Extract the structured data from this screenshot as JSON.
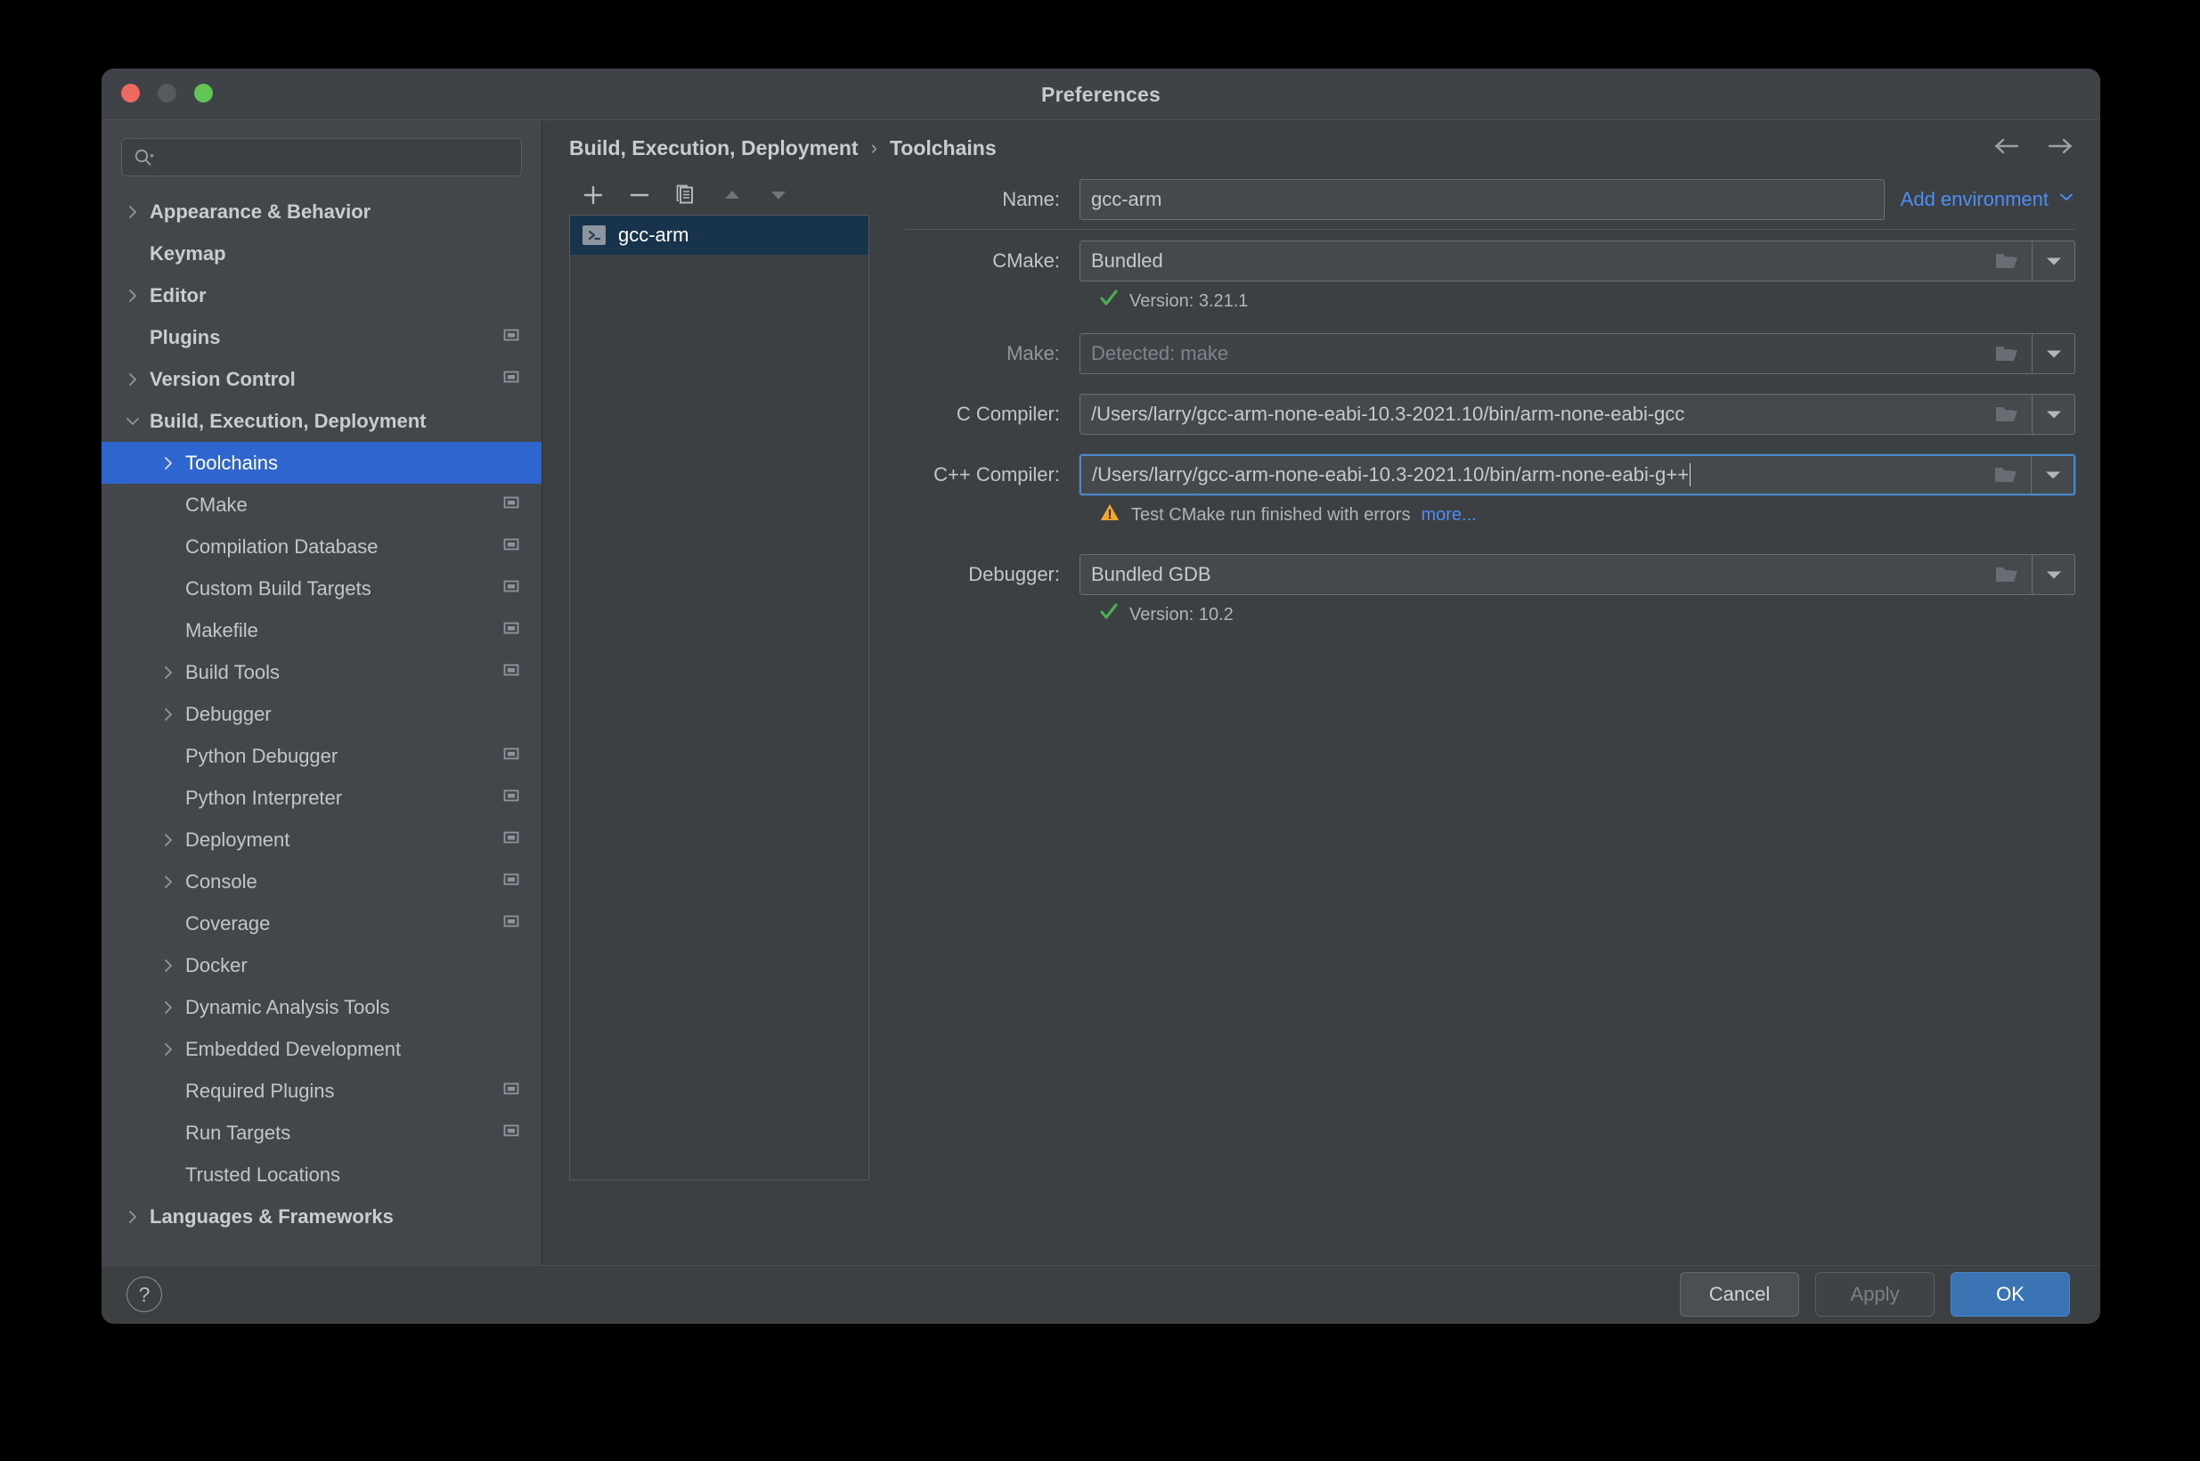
{
  "window": {
    "title": "Preferences",
    "traffic_lights": [
      "close",
      "minimize",
      "maximize"
    ]
  },
  "search": {
    "value": "",
    "placeholder": ""
  },
  "sidebar": {
    "items": [
      {
        "label": "Appearance & Behavior",
        "level": 0,
        "arrow": "right",
        "bold": true,
        "module": false,
        "selected": false
      },
      {
        "label": "Keymap",
        "level": 0,
        "arrow": "none",
        "bold": true,
        "module": false,
        "selected": false
      },
      {
        "label": "Editor",
        "level": 0,
        "arrow": "right",
        "bold": true,
        "module": false,
        "selected": false
      },
      {
        "label": "Plugins",
        "level": 0,
        "arrow": "none",
        "bold": true,
        "module": true,
        "selected": false
      },
      {
        "label": "Version Control",
        "level": 0,
        "arrow": "right",
        "bold": true,
        "module": true,
        "selected": false
      },
      {
        "label": "Build, Execution, Deployment",
        "level": 0,
        "arrow": "down",
        "bold": true,
        "module": false,
        "selected": false
      },
      {
        "label": "Toolchains",
        "level": 1,
        "arrow": "right",
        "bold": false,
        "module": false,
        "selected": true
      },
      {
        "label": "CMake",
        "level": 1,
        "arrow": "none",
        "bold": false,
        "module": true,
        "selected": false
      },
      {
        "label": "Compilation Database",
        "level": 1,
        "arrow": "none",
        "bold": false,
        "module": true,
        "selected": false
      },
      {
        "label": "Custom Build Targets",
        "level": 1,
        "arrow": "none",
        "bold": false,
        "module": true,
        "selected": false
      },
      {
        "label": "Makefile",
        "level": 1,
        "arrow": "none",
        "bold": false,
        "module": true,
        "selected": false
      },
      {
        "label": "Build Tools",
        "level": 1,
        "arrow": "right",
        "bold": false,
        "module": true,
        "selected": false
      },
      {
        "label": "Debugger",
        "level": 1,
        "arrow": "right",
        "bold": false,
        "module": false,
        "selected": false
      },
      {
        "label": "Python Debugger",
        "level": 1,
        "arrow": "none",
        "bold": false,
        "module": true,
        "selected": false
      },
      {
        "label": "Python Interpreter",
        "level": 1,
        "arrow": "none",
        "bold": false,
        "module": true,
        "selected": false
      },
      {
        "label": "Deployment",
        "level": 1,
        "arrow": "right",
        "bold": false,
        "module": true,
        "selected": false
      },
      {
        "label": "Console",
        "level": 1,
        "arrow": "right",
        "bold": false,
        "module": true,
        "selected": false
      },
      {
        "label": "Coverage",
        "level": 1,
        "arrow": "none",
        "bold": false,
        "module": true,
        "selected": false
      },
      {
        "label": "Docker",
        "level": 1,
        "arrow": "right",
        "bold": false,
        "module": false,
        "selected": false
      },
      {
        "label": "Dynamic Analysis Tools",
        "level": 1,
        "arrow": "right",
        "bold": false,
        "module": false,
        "selected": false
      },
      {
        "label": "Embedded Development",
        "level": 1,
        "arrow": "right",
        "bold": false,
        "module": false,
        "selected": false
      },
      {
        "label": "Required Plugins",
        "level": 1,
        "arrow": "none",
        "bold": false,
        "module": true,
        "selected": false
      },
      {
        "label": "Run Targets",
        "level": 1,
        "arrow": "none",
        "bold": false,
        "module": true,
        "selected": false
      },
      {
        "label": "Trusted Locations",
        "level": 1,
        "arrow": "none",
        "bold": false,
        "module": false,
        "selected": false
      },
      {
        "label": "Languages & Frameworks",
        "level": 0,
        "arrow": "right",
        "bold": true,
        "module": false,
        "selected": false
      }
    ]
  },
  "header": {
    "breadcrumb_parent": "Build, Execution, Deployment",
    "breadcrumb_separator": "›",
    "breadcrumb_current": "Toolchains",
    "back_icon": "arrow-left-icon",
    "forward_icon": "arrow-right-icon"
  },
  "toolchain_list": {
    "toolbar": [
      {
        "name": "add-toolchain-button",
        "icon": "plus-icon",
        "enabled": true
      },
      {
        "name": "remove-toolchain-button",
        "icon": "minus-icon",
        "enabled": true
      },
      {
        "name": "copy-toolchain-button",
        "icon": "copy-icon",
        "enabled": true
      },
      {
        "name": "move-up-button",
        "icon": "triangle-up-icon",
        "enabled": false
      },
      {
        "name": "move-down-button",
        "icon": "triangle-down-icon",
        "enabled": false
      }
    ],
    "items": [
      {
        "label": "gcc-arm",
        "icon": "terminal-icon",
        "selected": true
      }
    ]
  },
  "form": {
    "name": {
      "label": "Name:",
      "value": "gcc-arm"
    },
    "add_environment": {
      "label": "Add environment",
      "chevron": "chevron-down-icon"
    },
    "cmake": {
      "label": "CMake:",
      "value": "Bundled",
      "status_icon": "check-icon",
      "status_text": "Version: 3.21.1",
      "status_color": "#4caf50"
    },
    "make": {
      "label": "Make:",
      "placeholder": "Detected: make",
      "value": "",
      "disabled": true
    },
    "c_compiler": {
      "label": "C Compiler:",
      "value": "/Users/larry/gcc-arm-none-eabi-10.3-2021.10/bin/arm-none-eabi-gcc"
    },
    "cpp_compiler": {
      "label": "C++ Compiler:",
      "value": "/Users/larry/gcc-arm-none-eabi-10.3-2021.10/bin/arm-none-eabi-g++",
      "focused": true,
      "warning_icon": "warning-triangle-icon",
      "warning_text": "Test CMake run finished with errors",
      "warning_link": "more...",
      "warning_color": "#f0a732",
      "link_color": "#4d8ef5"
    },
    "debugger": {
      "label": "Debugger:",
      "value": "Bundled GDB",
      "status_icon": "check-icon",
      "status_text": "Version: 10.2",
      "status_color": "#4caf50"
    },
    "folder_icon": "folder-icon",
    "dropdown_icon": "triangle-down-icon"
  },
  "footer": {
    "help_label": "?",
    "cancel_label": "Cancel",
    "apply_label": "Apply",
    "ok_label": "OK",
    "accent_color": "#3b74b4"
  }
}
